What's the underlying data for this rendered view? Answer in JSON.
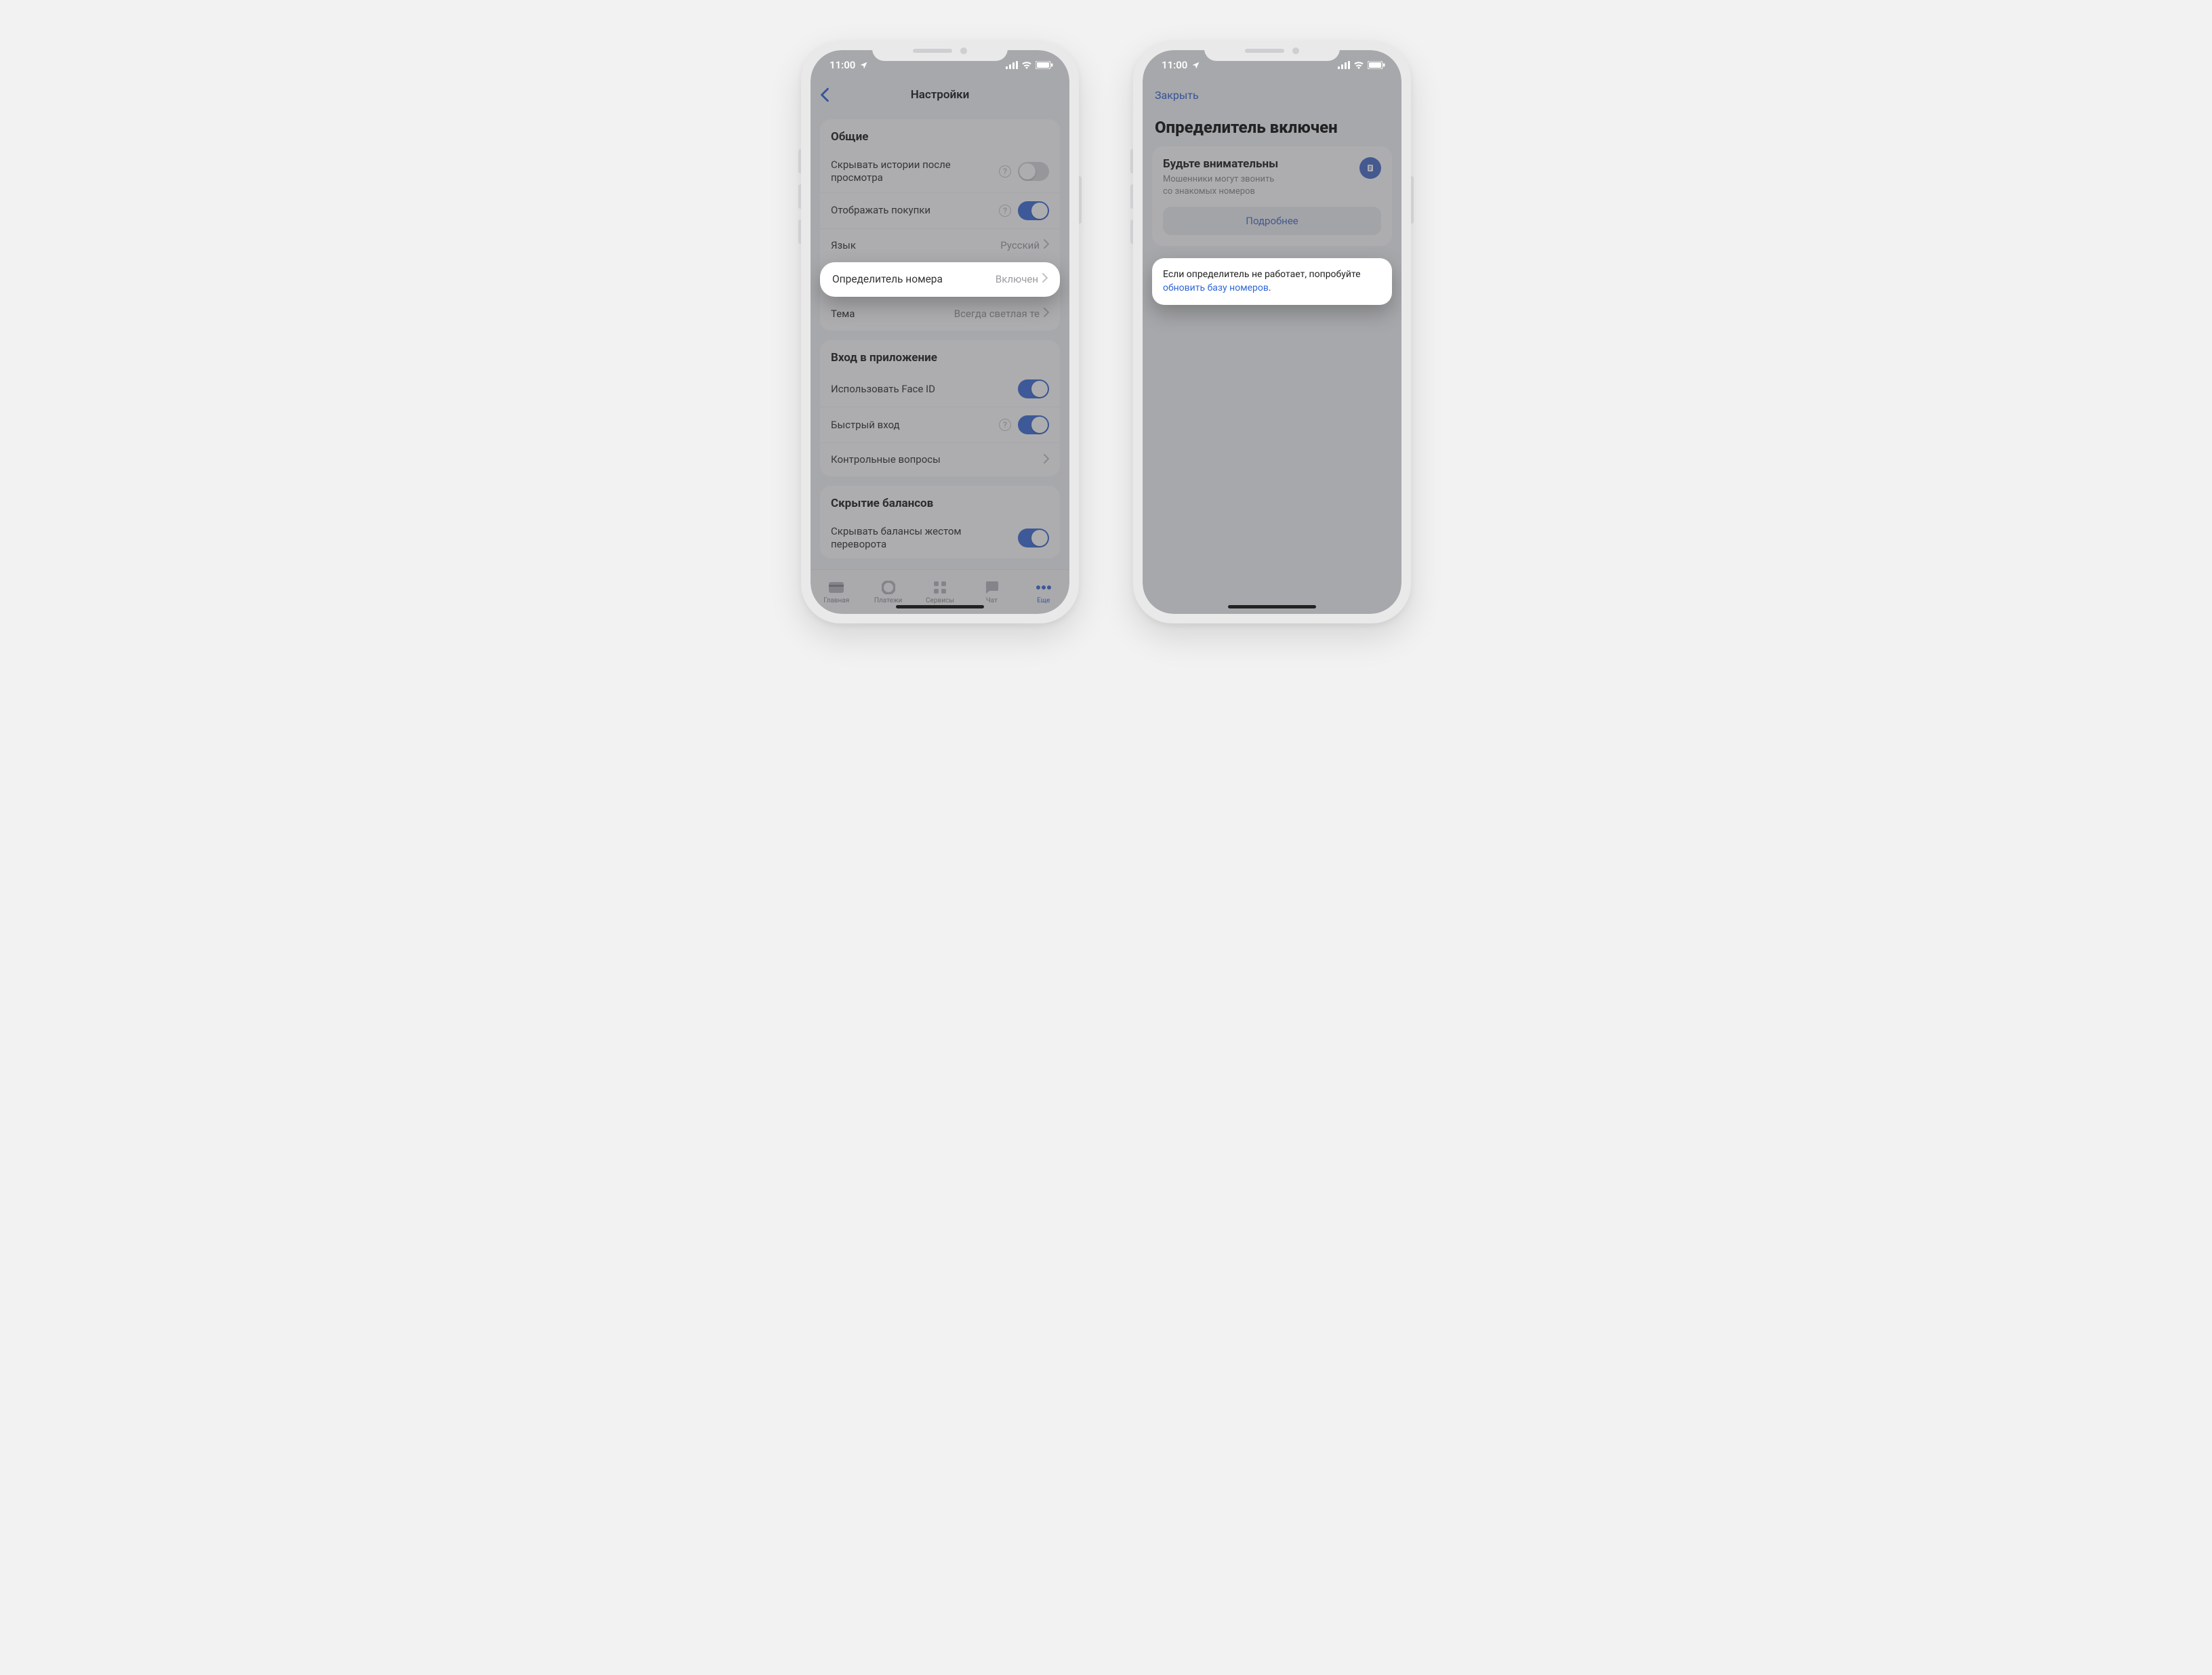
{
  "status": {
    "time": "11:00"
  },
  "left": {
    "nav_title": "Настройки",
    "sections": {
      "general": {
        "title": "Общие",
        "hide_stories": "Скрывать истории после просмотра",
        "show_purchases": "Отображать покупки",
        "lang_label": "Язык",
        "lang_value": "Русский",
        "caller_label": "Определитель номера",
        "caller_value": "Включен",
        "theme_label": "Тема",
        "theme_value": "Всегда светлая те"
      },
      "login": {
        "title": "Вход в приложение",
        "faceid": "Использовать Face ID",
        "fast": "Быстрый вход",
        "questions": "Контрольные вопросы"
      },
      "balances": {
        "title": "Скрытие балансов",
        "hide_gesture": "Скрывать балансы жестом переворота"
      }
    },
    "tabs": {
      "home": "Главная",
      "payments": "Платежи",
      "services": "Сервисы",
      "chat": "Чат",
      "more": "Еще"
    }
  },
  "right": {
    "close": "Закрыть",
    "title": "Определитель включен",
    "card": {
      "title": "Будьте внимательны",
      "subtitle": "Мошенники могут звонить\nсо знакомых номеров",
      "more": "Подробнее"
    },
    "tip_prefix": "Если определитель не работает, попробуйте ",
    "tip_link": "обновить базу номеров",
    "tip_suffix": "."
  }
}
